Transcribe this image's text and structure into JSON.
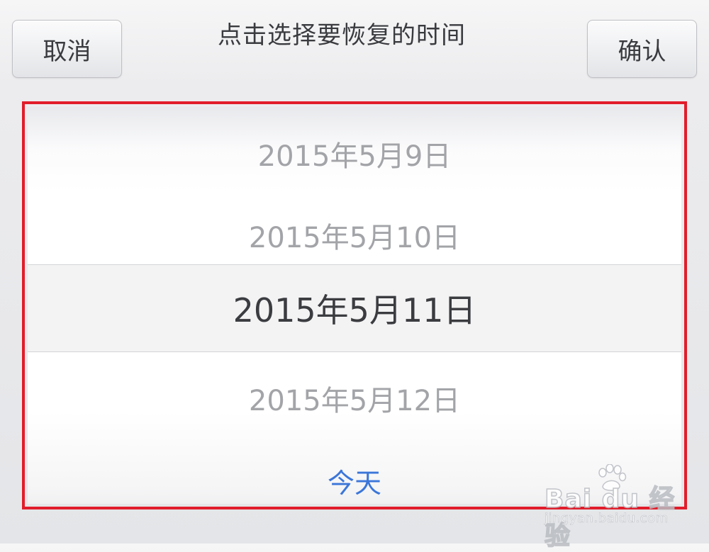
{
  "dialog": {
    "cancel_label": "取消",
    "title": "点击选择要恢复的时间",
    "confirm_label": "确认"
  },
  "picker": {
    "rows": [
      "2015年5月9日",
      "2015年5月10日",
      "2015年5月11日",
      "2015年5月12日"
    ],
    "selected": "2015年5月11日",
    "today_label": "今天"
  },
  "watermark": {
    "brand": "Bai du 经验",
    "url": "jingyan.baidu.com"
  },
  "colors": {
    "highlight_border": "#e11d2b",
    "link": "#3b76d9",
    "selected_text": "#3b3c40",
    "dim_text": "#a3a4a8"
  }
}
